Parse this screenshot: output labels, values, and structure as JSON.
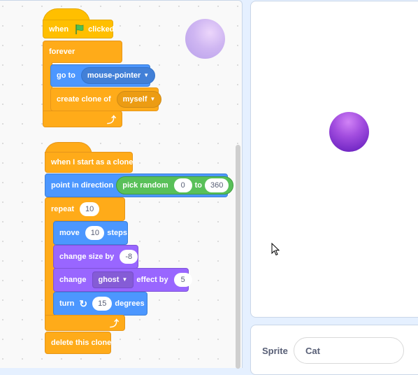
{
  "scripts": {
    "script1": {
      "hat": {
        "label_when": "when",
        "flag_icon": "green-flag",
        "label_clicked": "clicked"
      },
      "forever": {
        "label": "forever"
      },
      "goto": {
        "label": "go to",
        "target": "mouse-pointer"
      },
      "create_clone": {
        "label": "create clone of",
        "target": "myself"
      }
    },
    "script2": {
      "hat": {
        "label": "when I start as a clone"
      },
      "point": {
        "label": "point in direction",
        "op_label": "pick random",
        "from": "0",
        "to_label": "to",
        "to": "360"
      },
      "repeat": {
        "label": "repeat",
        "count": "10"
      },
      "move": {
        "label": "move",
        "steps": "10",
        "suffix": "steps"
      },
      "change_size": {
        "label": "change size by",
        "value": "-8"
      },
      "change_effect": {
        "label": "change",
        "effect": "ghost",
        "mid": "effect by",
        "value": "5"
      },
      "turn": {
        "label": "turn",
        "icon": "rotate-clockwise",
        "value": "15",
        "suffix": "degrees"
      },
      "delete": {
        "label": "delete this clone"
      }
    }
  },
  "sprite_panel": {
    "label": "Sprite",
    "name": "Cat"
  },
  "colors": {
    "events": "#ffbf00",
    "control": "#ffab19",
    "motion": "#4c97ff",
    "looks": "#9966ff",
    "operators": "#59c059"
  }
}
